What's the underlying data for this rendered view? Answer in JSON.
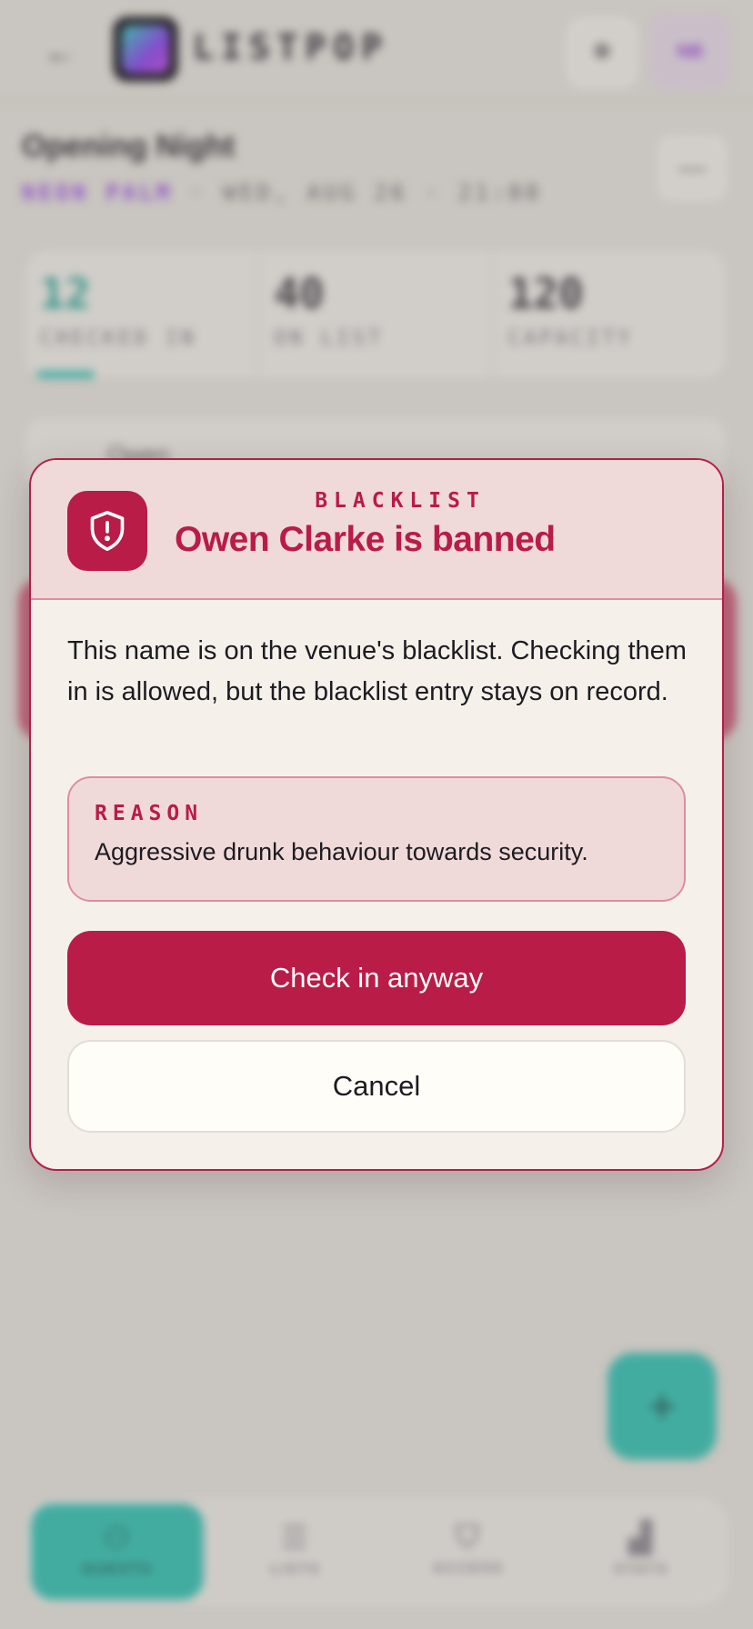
{
  "header": {
    "back_icon": "arrow-left-icon",
    "brand": "LISTPOP",
    "settings_icon": "gear-icon",
    "avatar_initials": "NB"
  },
  "event": {
    "title": "Opening Night",
    "venue": "NEON PALM",
    "datetime": "· WED, AUG 26 · 21:00"
  },
  "stats": [
    {
      "value": "12",
      "label": "CHECKED IN"
    },
    {
      "value": "40",
      "label": "ON LIST"
    },
    {
      "value": "120",
      "label": "CAPACITY"
    }
  ],
  "search": {
    "value": "Owen"
  },
  "nav": [
    {
      "label": "GUESTS",
      "icon": "user-icon"
    },
    {
      "label": "LISTS",
      "icon": "list-icon"
    },
    {
      "label": "ACCESS",
      "icon": "shield-icon"
    },
    {
      "label": "STATS",
      "icon": "bar-chart-icon"
    }
  ],
  "dialog": {
    "eyebrow": "BLACKLIST",
    "title": "Owen Clarke is banned",
    "body": "This name is on the venue's blacklist. Checking them in is allowed, but the blacklist entry stays on record.",
    "reason_label": "REASON",
    "reason_text": "Aggressive drunk behaviour towards security.",
    "primary_label": "Check in anyway",
    "secondary_label": "Cancel"
  },
  "colors": {
    "danger": "#b81c47",
    "danger_soft": "#f0dad9",
    "accent": "#2fc3b4",
    "brand_purple": "#a14ee8"
  }
}
